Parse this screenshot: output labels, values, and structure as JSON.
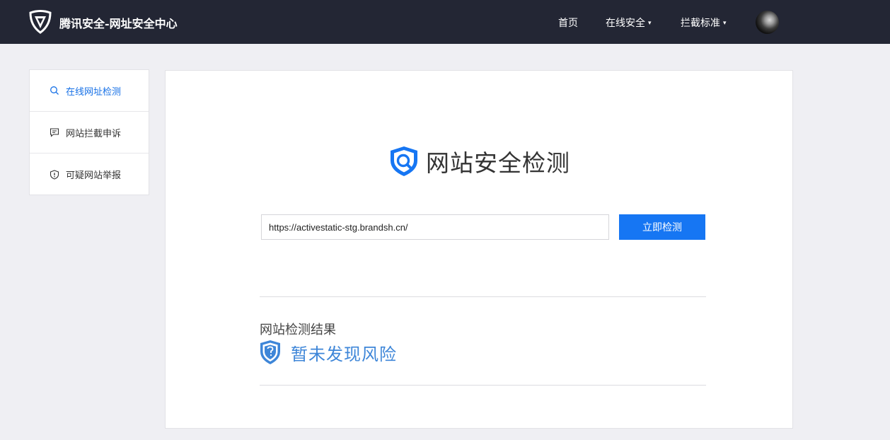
{
  "header": {
    "brand": "腾讯安全-网址安全中心",
    "nav": [
      {
        "label": "首页",
        "caret": ""
      },
      {
        "label": "在线安全",
        "caret": "▾"
      },
      {
        "label": "拦截标准",
        "caret": "▾"
      }
    ],
    "logo_icon": "tencent-shield-logo",
    "avatar_icon": "user-avatar"
  },
  "sidebar": {
    "items": [
      {
        "label": "在线网址检测",
        "icon": "search-icon",
        "active": true
      },
      {
        "label": "网站拦截申诉",
        "icon": "comment-icon",
        "active": false
      },
      {
        "label": "可疑网站举报",
        "icon": "shield-alert-icon",
        "active": false
      }
    ]
  },
  "main": {
    "title": "网站安全检测",
    "url_value": "https://activestatic-stg.brandsh.cn/",
    "check_button": "立即检测",
    "result_label": "网站检测结果",
    "result_text": "暂未发现风险"
  },
  "colors": {
    "accent": "#1676f3",
    "header_bg": "#232634",
    "result_blue": "#3e86d8"
  }
}
